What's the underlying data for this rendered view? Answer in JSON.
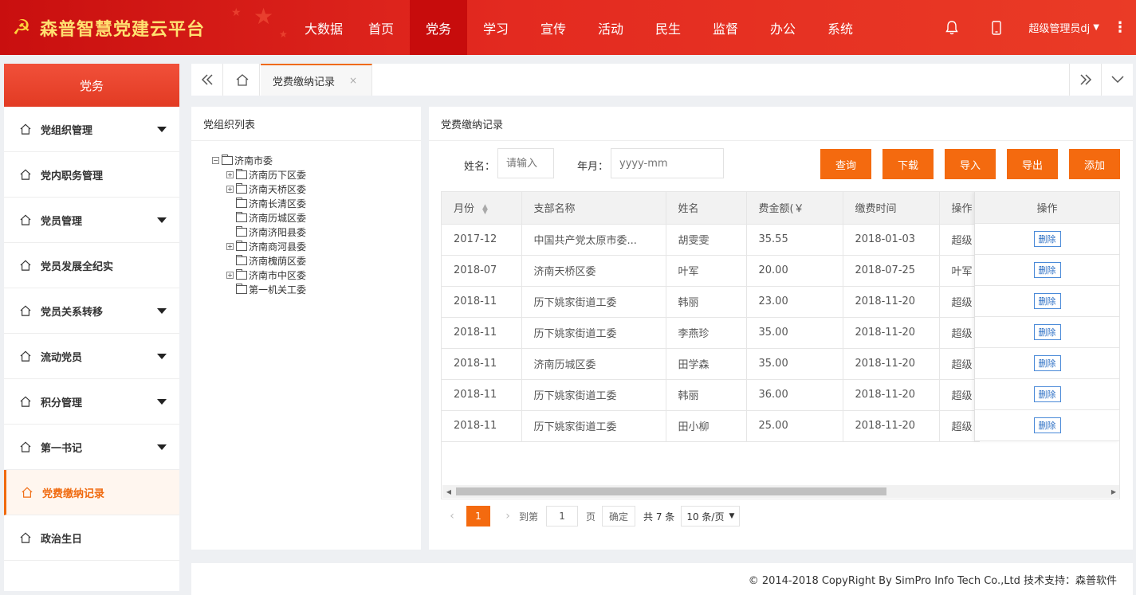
{
  "header": {
    "logo_text": "森普智慧党建云平台",
    "nav": [
      "大数据",
      "首页",
      "党务",
      "学习",
      "宣传",
      "活动",
      "民生",
      "监督",
      "办公",
      "系统"
    ],
    "active_nav": 2,
    "user": "超级管理员dj"
  },
  "sidebar": {
    "title": "党务",
    "items": [
      {
        "label": "党组织管理",
        "arrow": true
      },
      {
        "label": "党内职务管理",
        "arrow": false
      },
      {
        "label": "党员管理",
        "arrow": true
      },
      {
        "label": "党员发展全纪实",
        "arrow": false
      },
      {
        "label": "党员关系转移",
        "arrow": true
      },
      {
        "label": "流动党员",
        "arrow": true
      },
      {
        "label": "积分管理",
        "arrow": true
      },
      {
        "label": "第一书记",
        "arrow": true
      },
      {
        "label": "党费缴纳记录",
        "arrow": false,
        "active": true
      },
      {
        "label": "政治生日",
        "arrow": false
      }
    ]
  },
  "tabbar": {
    "tab_label": "党费缴纳记录",
    "close": "×"
  },
  "left_panel": {
    "title": "党组织列表",
    "tree": [
      {
        "label": "济南市委",
        "level": 0,
        "toggle": "−"
      },
      {
        "label": "济南历下区委",
        "level": 1,
        "toggle": "+"
      },
      {
        "label": "济南天桥区委",
        "level": 1,
        "toggle": "+"
      },
      {
        "label": "济南长清区委",
        "level": 1,
        "toggle": ""
      },
      {
        "label": "济南历城区委",
        "level": 1,
        "toggle": ""
      },
      {
        "label": "济南济阳县委",
        "level": 1,
        "toggle": ""
      },
      {
        "label": "济南商河县委",
        "level": 1,
        "toggle": "+"
      },
      {
        "label": "济南槐荫区委",
        "level": 1,
        "toggle": ""
      },
      {
        "label": "济南市中区委",
        "level": 1,
        "toggle": "+"
      },
      {
        "label": "第一机关工委",
        "level": 1,
        "toggle": ""
      }
    ]
  },
  "right_panel": {
    "title": "党费缴纳记录",
    "filters": {
      "name_label": "姓名：",
      "name_placeholder": "请输入",
      "month_label": "年月：",
      "month_placeholder": "yyyy-mm"
    },
    "buttons": [
      "查询",
      "下载",
      "导入",
      "导出",
      "添加"
    ],
    "table": {
      "headers": [
        "月份",
        "支部名称",
        "姓名",
        "费金额(￥",
        "缴费时间",
        "操作"
      ],
      "op_header": "操作",
      "rows": [
        [
          "2017-12",
          "中国共产党太原市委...",
          "胡雯雯",
          "35.55",
          "2018-01-03",
          "超级"
        ],
        [
          "2018-07",
          "济南天桥区委",
          "叶军",
          "20.00",
          "2018-07-25",
          "叶军"
        ],
        [
          "2018-11",
          "历下姚家街道工委",
          "韩丽",
          "23.00",
          "2018-11-20",
          "超级"
        ],
        [
          "2018-11",
          "历下姚家街道工委",
          "李燕珍",
          "35.00",
          "2018-11-20",
          "超级"
        ],
        [
          "2018-11",
          "济南历城区委",
          "田学森",
          "35.00",
          "2018-11-20",
          "超级"
        ],
        [
          "2018-11",
          "历下姚家街道工委",
          "韩丽",
          "36.00",
          "2018-11-20",
          "超级"
        ],
        [
          "2018-11",
          "历下姚家街道工委",
          "田小柳",
          "25.00",
          "2018-11-20",
          "超级"
        ]
      ],
      "delete_label": "删除"
    },
    "pager": {
      "current": "1",
      "goto_label": "到第",
      "page_value": "1",
      "page_label": "页",
      "confirm": "确定",
      "total": "共 7 条",
      "per_page": "10 条/页"
    }
  },
  "footer": {
    "text": "© 2014-2018 CopyRight By SimPro Info Tech Co.,Ltd 技术支持：森普软件"
  }
}
